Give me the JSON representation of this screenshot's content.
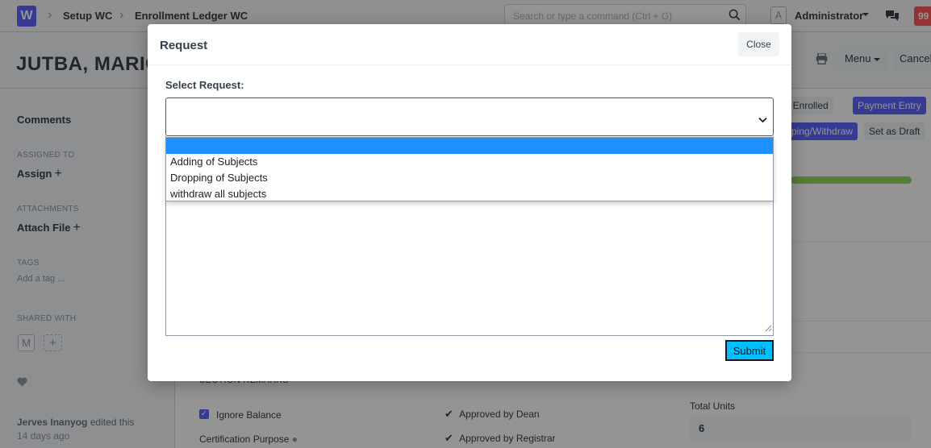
{
  "navbar": {
    "logo_letter": "W",
    "breadcrumbs": [
      "Setup WC",
      "Enrollment Ledger WC"
    ],
    "search_placeholder": "Search or type a command (Ctrl + G)",
    "avatar_letter": "A",
    "user_name": "Administrator",
    "notification_count": "99"
  },
  "page": {
    "title": "JUTBA, MARICE",
    "menu_label": "Menu",
    "cancel_label": "Cancel",
    "status_buttons": {
      "fully_enrolled": "lly Enrolled",
      "payment_entry": "Payment Entry",
      "dropping_withdraw": "ping/Withdraw",
      "set_as_draft": "Set as Draft"
    }
  },
  "sidebar": {
    "comments": "Comments",
    "assigned_to_caption": "ASSIGNED TO",
    "assign_label": "Assign",
    "attachments_caption": "ATTACHMENTS",
    "attach_label": "Attach File",
    "tags_caption": "TAGS",
    "add_tag": "Add a tag ...",
    "shared_caption": "SHARED WITH",
    "shared_avatar": "M",
    "activity_user": "Jerves Inanyog",
    "activity_text": "edited this",
    "activity_time": "14 days ago"
  },
  "form": {
    "section_label": "SECTION REMARKS",
    "ignore_balance": "Ignore Balance",
    "certification_purpose": "Certification Purpose",
    "approved_dean": "Approved by Dean",
    "approved_registrar": "Approved by Registrar",
    "total_units_label": "Total Units",
    "total_units_value": "6"
  },
  "modal": {
    "title": "Request",
    "close_label": "Close",
    "select_label": "Select Request:",
    "selected_value": "",
    "options": [
      "",
      "Adding of Subjects",
      "Dropping of Subjects",
      "withdraw all subjects"
    ],
    "submit_label": "Submit"
  },
  "colors": {
    "accent": "#5e64ff",
    "selected_option": "#1e90ff",
    "submit": "#00bfff",
    "indicator": "#98d85b"
  }
}
